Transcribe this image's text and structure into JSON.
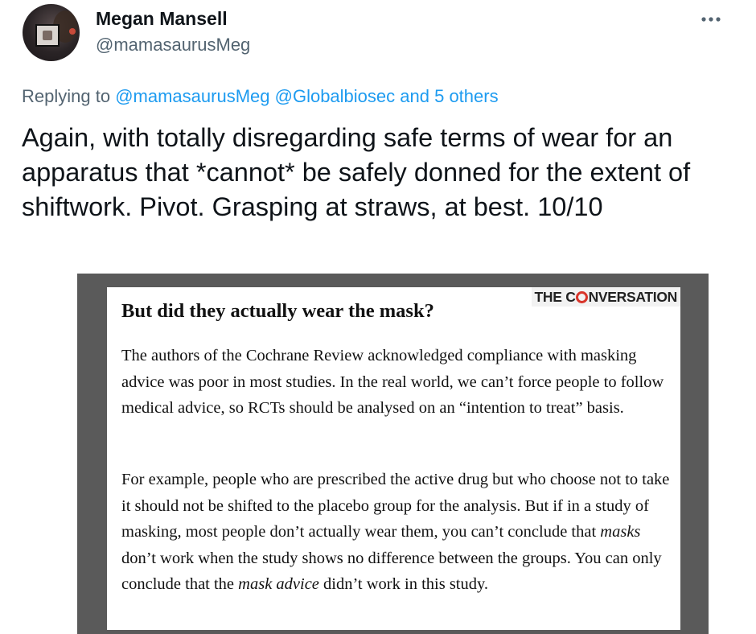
{
  "author": {
    "display_name": "Megan Mansell",
    "handle": "@mamasaurusMeg",
    "avatar_icon": "profile-photo-avatar"
  },
  "menu": {
    "more_icon": "more-horizontal-icon"
  },
  "reply": {
    "prefix": "Replying to",
    "mention_1": "@mamasaurusMeg",
    "mention_2": "@Globalbiosec",
    "others": "and 5 others"
  },
  "tweet": {
    "text": "Again, with totally disregarding safe terms of wear for an apparatus that *cannot* be safely donned for the extent of shiftwork. Pivot. Grasping at straws, at best. 10/10"
  },
  "media": {
    "heading": "But did they actually wear the mask?",
    "brand": {
      "before": "THE C",
      "after": "NVERSATION",
      "accent_color": "#d8352a"
    },
    "paragraph_1": "The authors of the Cochrane Review acknowledged compliance with masking advice was poor in most studies. In the real world, we can’t force people to follow medical advice, so RCTs should be analysed on an “intention to treat” basis.",
    "paragraph_2": {
      "part_1": "For example, people who are prescribed the active drug but who choose not to take it should not be shifted to the placebo group for the analysis. But if in a study of masking, most people don’t actually wear them, you can’t conclude that ",
      "italic_1": "masks",
      "part_2": " don’t work when the study shows no difference between the groups. You can only conclude that the ",
      "italic_2": "mask advice",
      "part_3": " didn’t work in this study."
    }
  },
  "colors": {
    "text_primary": "#0f1419",
    "text_secondary": "#536471",
    "link": "#1d9bf0",
    "media_backdrop": "#5a5a5a"
  }
}
